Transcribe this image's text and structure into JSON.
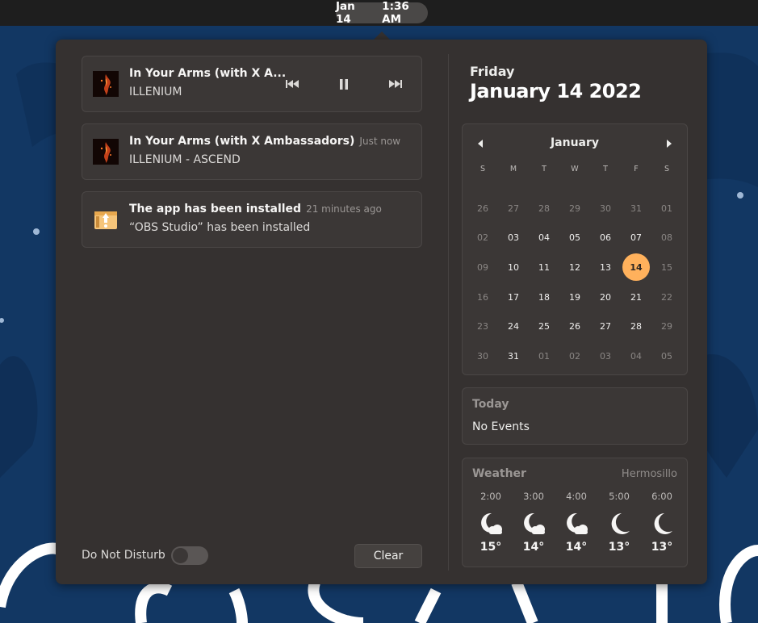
{
  "topbar": {
    "date": "Jan 14",
    "time": "1:36 AM"
  },
  "media": {
    "title": "In Your Arms (with X A...",
    "artist": "ILLENIUM"
  },
  "notifications": [
    {
      "title": "In Your Arms (with X Ambassadors)",
      "time": "Just now",
      "body": "ILLENIUM - ASCEND"
    },
    {
      "title": "The app has been installed",
      "time": "21 minutes ago",
      "body": "“OBS Studio” has been installed"
    }
  ],
  "dnd_label": "Do Not Disturb",
  "clear_label": "Clear",
  "weekday": "Friday",
  "fulldate": "January 14 2022",
  "calendar": {
    "month": "January",
    "day_headers": [
      "S",
      "M",
      "T",
      "W",
      "T",
      "F",
      "S"
    ],
    "weeks": [
      [
        "26",
        "27",
        "28",
        "29",
        "30",
        "31",
        "01"
      ],
      [
        "02",
        "03",
        "04",
        "05",
        "06",
        "07",
        "08"
      ],
      [
        "09",
        "10",
        "11",
        "12",
        "13",
        "14",
        "15"
      ],
      [
        "16",
        "17",
        "18",
        "19",
        "20",
        "21",
        "22"
      ],
      [
        "23",
        "24",
        "25",
        "26",
        "27",
        "28",
        "29"
      ],
      [
        "30",
        "31",
        "01",
        "02",
        "03",
        "04",
        "05"
      ]
    ],
    "today": "14"
  },
  "events": {
    "header": "Today",
    "empty": "No Events"
  },
  "weather": {
    "header": "Weather",
    "location": "Hermosillo",
    "forecast": [
      {
        "time": "2:00",
        "icon": "night-cloudy-icon",
        "temp": "15°"
      },
      {
        "time": "3:00",
        "icon": "night-cloudy-icon",
        "temp": "14°"
      },
      {
        "time": "4:00",
        "icon": "night-cloudy-icon",
        "temp": "14°"
      },
      {
        "time": "5:00",
        "icon": "moon-icon",
        "temp": "13°"
      },
      {
        "time": "6:00",
        "icon": "moon-icon",
        "temp": "13°"
      }
    ]
  },
  "colors": {
    "accent": "#ffb15c",
    "panel": "#353130",
    "card": "#3b3736",
    "wallpaper": "#123763"
  }
}
